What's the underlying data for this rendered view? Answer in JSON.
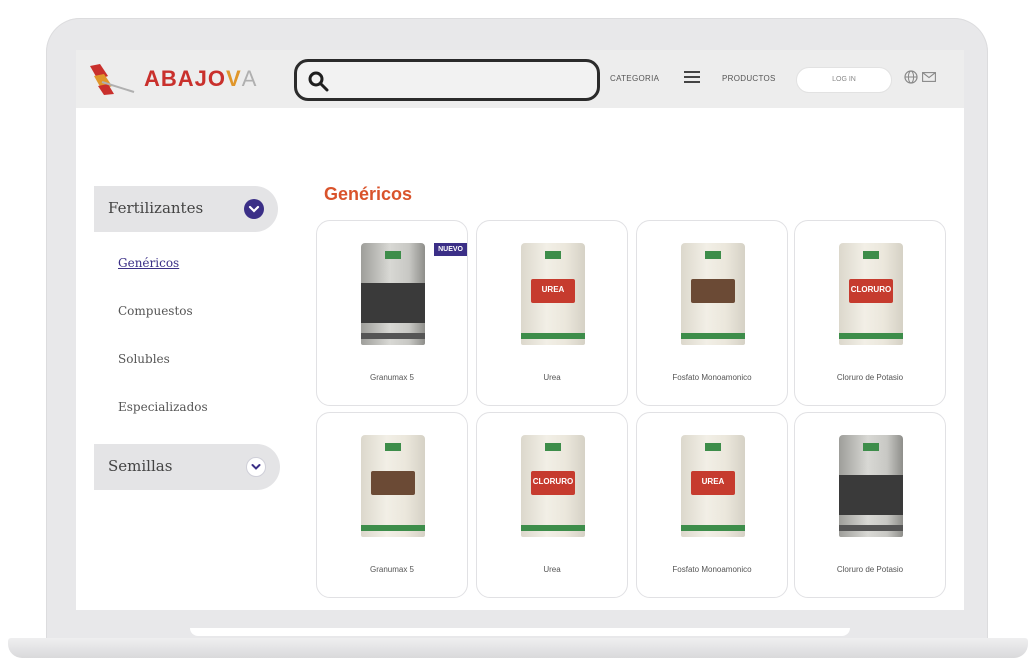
{
  "colors": {
    "brand_red": "#c9302c",
    "brand_orange": "#e0962a",
    "accent_purple": "#3b2f87",
    "heading_orange": "#d9532b"
  },
  "header": {
    "brand_part1": "ABAJO",
    "brand_part2": "V",
    "brand_part3": "A",
    "logo_icon": "abajova-wings-logo-icon",
    "search_icon": "search-icon",
    "search_placeholder": "",
    "categoria_label": "CATEGORIA",
    "menu_icon": "hamburger-menu-icon",
    "productos_label": "PRODUCTOS",
    "login_label": "LOG IN",
    "globe_icon": "globe-icon",
    "mail_icon": "mail-icon"
  },
  "sidebar": {
    "categories": [
      {
        "label": "Fertilizantes",
        "icon": "chevron-down-icon",
        "expanded": true,
        "items": [
          {
            "label": "Genéricos",
            "active": true
          },
          {
            "label": "Compuestos",
            "active": false
          },
          {
            "label": "Solubles",
            "active": false
          },
          {
            "label": "Especializados",
            "active": false
          }
        ]
      },
      {
        "label": "Semillas",
        "icon": "chevron-down-icon",
        "expanded": false
      }
    ]
  },
  "main": {
    "heading": "Genéricos",
    "badge": "NUEVO",
    "products": [
      {
        "name": "Granumax 5",
        "image_icon": "product-bag-icon",
        "bag": "grey",
        "band_color": "#3a3a3a",
        "band_text": ""
      },
      {
        "name": "Urea",
        "image_icon": "product-bag-icon",
        "bag": "white",
        "band_color": "#c63b2e",
        "band_text": "UREA"
      },
      {
        "name": "Fosfato Monoamonico",
        "image_icon": "product-bag-icon",
        "bag": "white",
        "band_color": "#6b4a35",
        "band_text": ""
      },
      {
        "name": "Cloruro de Potasio",
        "image_icon": "product-bag-icon",
        "bag": "white",
        "band_color": "#c63b2e",
        "band_text": "CLORURO"
      },
      {
        "name": "Granumax 5",
        "image_icon": "product-bag-icon",
        "bag": "white",
        "band_color": "#6b4a35",
        "band_text": ""
      },
      {
        "name": "Urea",
        "image_icon": "product-bag-icon",
        "bag": "white",
        "band_color": "#c63b2e",
        "band_text": "CLORURO"
      },
      {
        "name": "Fosfato Monoamonico",
        "image_icon": "product-bag-icon",
        "bag": "white",
        "band_color": "#c63b2e",
        "band_text": "UREA"
      },
      {
        "name": "Cloruro de Potasio",
        "image_icon": "product-bag-icon",
        "bag": "grey",
        "band_color": "#3a3a3a",
        "band_text": ""
      }
    ]
  }
}
